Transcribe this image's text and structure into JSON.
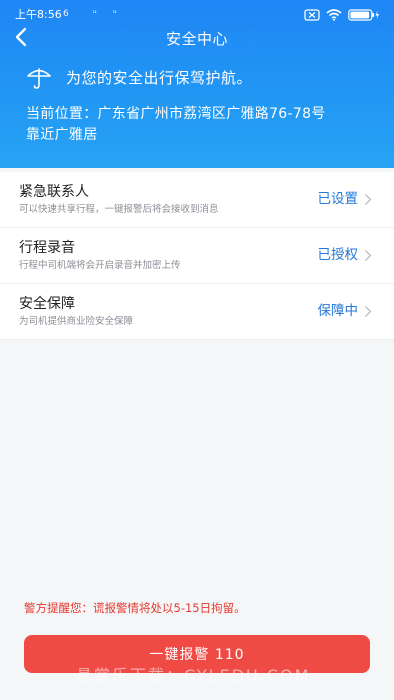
{
  "status_bar": {
    "time": "上午8:56",
    "indicator_1": "6",
    "indicator_2": "ᵘ",
    "indicator_3": "ᵘ",
    "battery_level": 0.95
  },
  "nav": {
    "back_icon": "chevron-left-icon",
    "title": "安全中心"
  },
  "banner": {
    "icon": "umbrella-icon",
    "text": "为您的安全出行保驾护航。",
    "location_line1": "当前位置：广东省广州市荔湾区广雅路76-78号",
    "location_line2": "靠近广雅居"
  },
  "items": [
    {
      "title": "紧急联系人",
      "subtitle": "可以快速共享行程，一键报警后将会接收到消息",
      "status": "已设置"
    },
    {
      "title": "行程录音",
      "subtitle": "行程中司机端将会开启录音并加密上传",
      "status": "已授权"
    },
    {
      "title": "安全保障",
      "subtitle": "为司机提供商业险安全保障",
      "status": "保障中"
    }
  ],
  "warning": "警方提醒您：谎报警情将处以5-15日拘留。",
  "sos_button": "一键报警 110",
  "watermark": "悬赏乐下载：CYLEDU.COM",
  "colors": {
    "header_blue": "#2196f3",
    "status_blue": "#2478d8",
    "alert_red": "#f04a45"
  }
}
